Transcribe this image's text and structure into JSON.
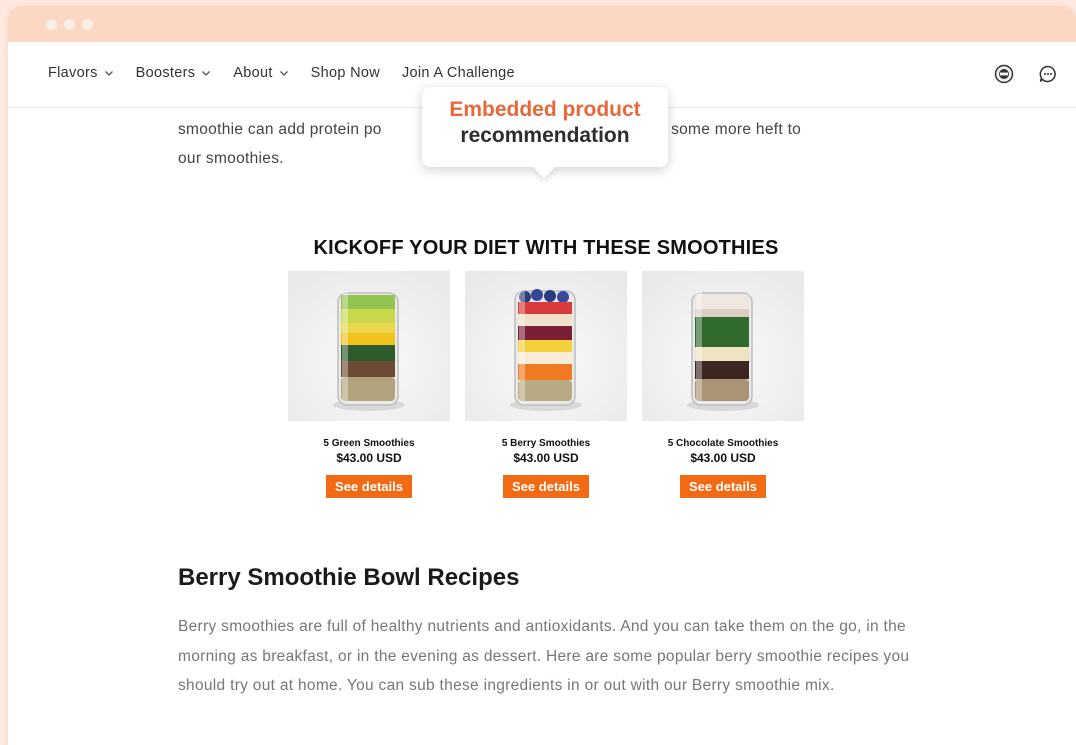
{
  "nav": {
    "items": [
      {
        "label": "Flavors",
        "dropdown": true
      },
      {
        "label": "Boosters",
        "dropdown": true
      },
      {
        "label": "About",
        "dropdown": true
      },
      {
        "label": "Shop Now",
        "dropdown": false
      },
      {
        "label": "Join A Challenge",
        "dropdown": false
      }
    ],
    "icons": [
      "badge-icon",
      "chat-icon"
    ]
  },
  "intro": {
    "text_left": "smoothie can add protein po",
    "text_right": "add some more heft to",
    "text_line2": "our smoothies."
  },
  "callout": {
    "line1": "Embedded product",
    "line2": "recommendation",
    "accent_color": "#e8683a"
  },
  "products_section": {
    "heading": "KICKOFF YOUR DIET WITH THESE SMOOTHIES",
    "button_color": "#f26a14",
    "items": [
      {
        "name": "5 Green Smoothies",
        "price": "$43.00 USD",
        "button": "See details"
      },
      {
        "name": "5 Berry Smoothies",
        "price": "$43.00 USD",
        "button": "See details"
      },
      {
        "name": "5 Chocolate Smoothies",
        "price": "$43.00 USD",
        "button": "See details"
      }
    ]
  },
  "article": {
    "title": "Berry Smoothie Bowl Recipes",
    "body": "Berry smoothies are full of healthy nutrients and antioxidants. And you can take them on the go, in the morning as breakfast, or in the evening as dessert. Here are some popular berry smoothie recipes you should try out at home. You can sub these ingredients in or out with our Berry smoothie mix."
  }
}
